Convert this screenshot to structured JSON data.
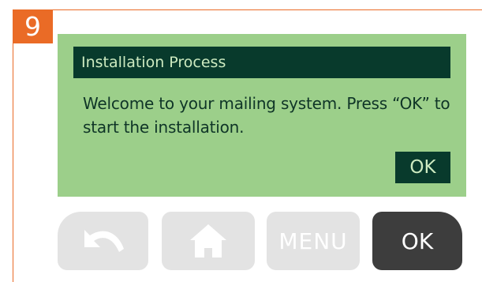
{
  "step": {
    "number": "9"
  },
  "screen": {
    "title": "Installation Process",
    "message": "Welcome to your mailing system. Press “OK” to start the installation.",
    "ok_label": "OK"
  },
  "buttons": {
    "back_icon": "back-arrow-icon",
    "home_icon": "home-icon",
    "menu_label": "MENU",
    "ok_label": "OK"
  },
  "colors": {
    "accent": "#ea6b26",
    "screen_bg": "#9ccf8a",
    "screen_dark": "#083a2c",
    "button_light": "#e3e3e3",
    "button_dark": "#3d3d3d"
  }
}
